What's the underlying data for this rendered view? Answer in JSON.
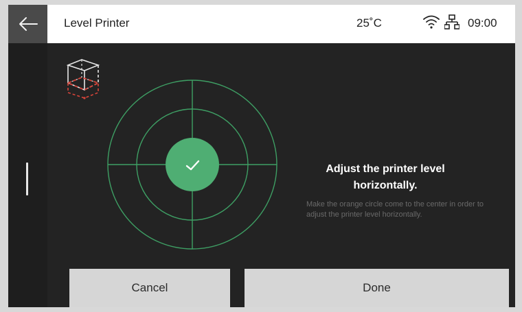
{
  "header": {
    "title": "Level Printer",
    "temperature": "25˚C",
    "time": "09:00",
    "icons": [
      "back-arrow-icon",
      "wifi-icon",
      "network-icon"
    ]
  },
  "level": {
    "status_icon": "checkmark-icon",
    "accent": "#4fae73",
    "ring_color": "#3e9f64"
  },
  "message": {
    "title": "Adjust the printer level horizontally.",
    "body": "Make the orange circle come to the center in order to adjust the printer level horizontally."
  },
  "buttons": {
    "cancel": "Cancel",
    "done": "Done"
  }
}
